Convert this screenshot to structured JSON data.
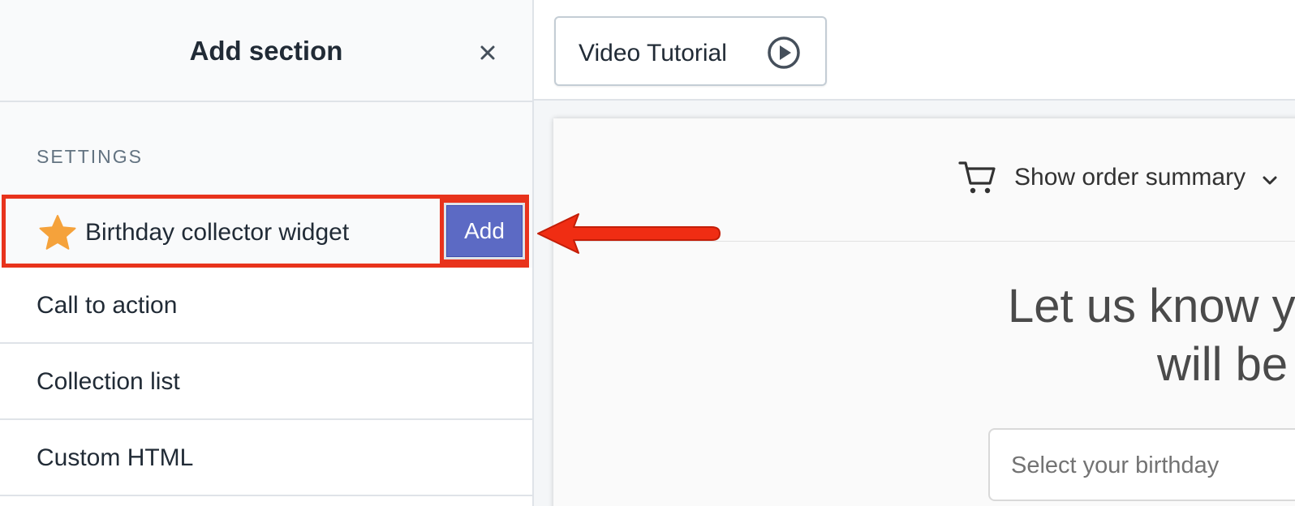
{
  "panel": {
    "title": "Add section",
    "settings_label": "SETTINGS",
    "highlighted_item": {
      "label": "Birthday collector widget",
      "add_label": "Add",
      "icon": "star-icon"
    },
    "items": [
      {
        "label": "Call to action"
      },
      {
        "label": "Collection list"
      },
      {
        "label": "Custom HTML"
      }
    ]
  },
  "toolbar": {
    "video_label": "Video Tutorial",
    "video_icon": "play-circle-icon"
  },
  "preview": {
    "summary_label": "Show order summary",
    "headline_line1": "Let us know y",
    "headline_line2": "will be",
    "select_placeholder": "Select your birthday"
  },
  "colors": {
    "accent": "#5c6ac4",
    "highlight": "#e8331c",
    "star": "#f5a23b"
  }
}
